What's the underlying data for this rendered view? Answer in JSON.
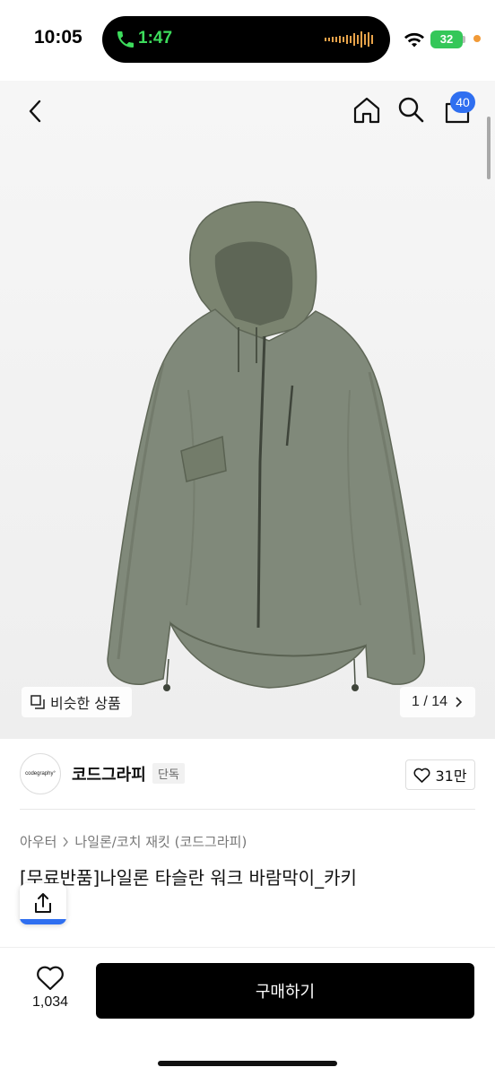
{
  "status_bar": {
    "time": "10:05",
    "call_duration": "1:47",
    "battery": "32"
  },
  "nav": {
    "cart_count": "40",
    "icons": [
      "back-icon",
      "home-icon",
      "search-icon",
      "shopping-bag-icon"
    ]
  },
  "gallery": {
    "similar_label": "비슷한 상품",
    "counter": "1 / 14"
  },
  "brand": {
    "logo_text": "codegraphy°",
    "name": "코드그라피",
    "badge": "단독",
    "likes": "31만"
  },
  "breadcrumb": [
    "아우터",
    "나일론/코치 재킷 (코드그라피)"
  ],
  "product": {
    "title": "[무료반품]나일론 타슬란 워크 바람막이_카키"
  },
  "bottom_bar": {
    "wish_count": "1,034",
    "buy_label": "구매하기"
  },
  "colors": {
    "accent": "#2f6ff0",
    "call_green": "#3ddc5c",
    "battery_green": "#34c759",
    "jacket_khaki": "#7d8670",
    "buy_button": "#000000"
  }
}
